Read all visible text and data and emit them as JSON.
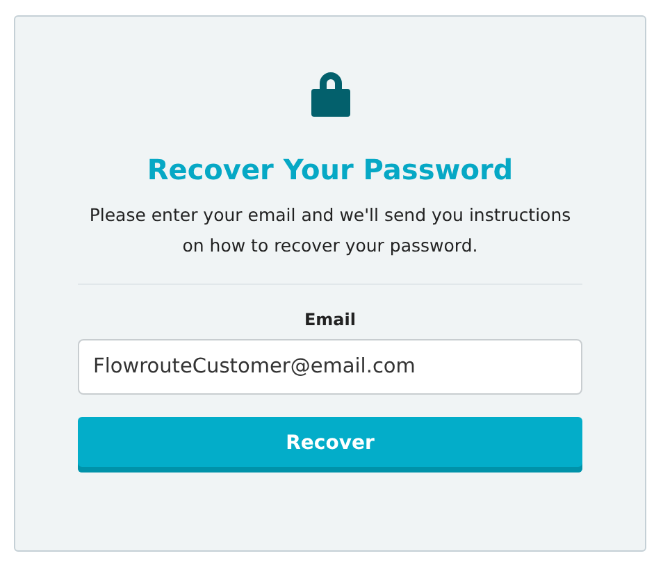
{
  "title": "Recover Your Password",
  "description": "Please enter your email and we'll send you instructions on how to recover your password.",
  "email_field": {
    "label": "Email",
    "value": "FlowrouteCustomer@email.com"
  },
  "button": "Recover"
}
